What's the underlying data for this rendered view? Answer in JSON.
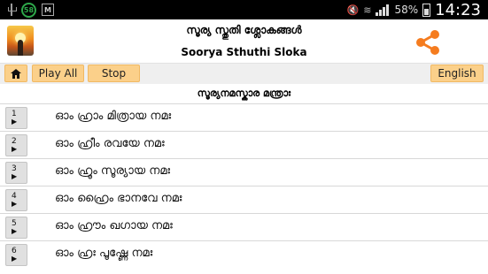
{
  "status_bar": {
    "badge": "58",
    "battery": "58%",
    "time": "14:23"
  },
  "header": {
    "title_malayalam": "സൂര്യ സ്തുതി ശ്ലോകങ്ങൾ",
    "title_english": "Soorya Sthuthi Sloka",
    "share_icon": "share-icon",
    "accent_color": "#f57c1f"
  },
  "toolbar": {
    "home_icon": "home-icon",
    "play_all_label": "Play All",
    "stop_label": "Stop",
    "language_label": "English",
    "button_color": "#fbd08a"
  },
  "section": {
    "title": "സൂര്യനമസ്കാര മന്ത്രാഃ"
  },
  "list": {
    "items": [
      {
        "number": "1",
        "play_icon": "▶",
        "text": "ഓം ഹ്രാം മിത്രായ നമഃ"
      },
      {
        "number": "2",
        "play_icon": "▶",
        "text": "ഓം ഹ്രീം രവയേ നമഃ"
      },
      {
        "number": "3",
        "play_icon": "▶",
        "text": "ഓം ഹ്രൂം സൂര്യായ നമഃ"
      },
      {
        "number": "4",
        "play_icon": "▶",
        "text": "ഓം ഹ്രൈം ഭാനവേ നമഃ"
      },
      {
        "number": "5",
        "play_icon": "▶",
        "text": "ഓം ഹ്രൗം ഖഗായ നമഃ"
      },
      {
        "number": "6",
        "play_icon": "▶",
        "text": "ഓം ഹ്രഃ പൂഷ്ണേ നമഃ"
      }
    ]
  }
}
